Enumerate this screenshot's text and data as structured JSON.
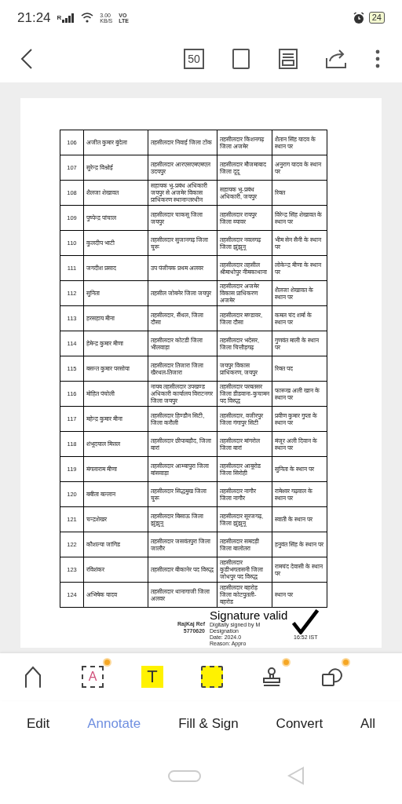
{
  "status_bar": {
    "time": "21:24",
    "carrier_mark": "R",
    "speed_value": "3.00",
    "speed_unit": "KB/S",
    "volte_top": "VO",
    "volte_bottom": "LTE",
    "battery": "24"
  },
  "toolbar": {
    "zoom_label": "50"
  },
  "document": {
    "rows": [
      {
        "number": "106",
        "name": "अजीत कुमार बुंदेला",
        "from": "तहसीलदार निवाई जिला टोंक",
        "to": "तहसीलदार किशनगढ़ जिला अजमेर",
        "remark": "शैतान सिंह यादव के स्थान पर"
      },
      {
        "number": "107",
        "name": "सुरेन्द्र विश्नोई",
        "from": "तहसीलदार आरएसएमएमएल उदयपुर",
        "to": "तहसीलदार मौजमाबाद जिला दूदू",
        "remark": "अनुराग यादव के स्थान पर"
      },
      {
        "number": "108",
        "name": "शैलजा शेखावत",
        "from": "सहायक भू-प्रबंध अधिकारी जयपुर से अजमेर विकास प्राधिकरण स्थानान्तरधीन",
        "to": "सहायक भू-प्रबंध अधिकारी, जयपुर",
        "remark": "रिक्त"
      },
      {
        "number": "109",
        "name": "पुष्पेन्द्र पांचाल",
        "from": "तहसीलदार चाकसू जिला जयपुर",
        "to": "तहसीलदार रायपुर जिला ब्यावर",
        "remark": "विरेन्द्र सिंह शेखावत के स्थान पर"
      },
      {
        "number": "110",
        "name": "कुलदीप भाटी",
        "from": "तहसीलदार सुजानगढ़ जिला चुरू",
        "to": "तहसीलदार नवलगढ़ जिला झुंझुनू",
        "remark": "भीम सेन सैनी के स्थान पर"
      },
      {
        "number": "111",
        "name": "जगदीश प्रसाद",
        "from": "उप पंजीयक प्रथम अलवर",
        "to": "तहसीलदार तहसील श्रीमाधोपुर नीमकाथाना",
        "remark": "लोकेन्द्र मीणा के स्थान पर"
      },
      {
        "number": "112",
        "name": "सुनिता",
        "from": "तहसील जोबनेर जिला जयपुर",
        "to": "तहसीलदार अजमेर विकास प्राधिकरण अजमेर",
        "remark": "शैलजा शेखावत के स्थान पर"
      },
      {
        "number": "113",
        "name": "हरसहाय मीना",
        "from": "तहसीलदार, सैंथल, जिला दौसा",
        "to": "तहसीलदार मण्डावर, जिला दौसा",
        "remark": "कमल चंद शर्मा के स्थान पर"
      },
      {
        "number": "114",
        "name": "हेमेन्द्र कुमार मीणा",
        "from": "तहसीलदार कोटडी जिला भीलवाड़ा",
        "to": "तहसीलदार भदेसर, जिला चित्तौड़गढ़",
        "remark": "गुणवंत माली के स्थान पर"
      },
      {
        "number": "115",
        "name": "बसन्त कुमार परसोया",
        "from": "तहसीलदार तिजारा जिला खैरथल-तिजारा",
        "to": "जयपुर विकास प्राधिकरण, जयपुर",
        "remark": "रिक्त पद"
      },
      {
        "number": "116",
        "name": "मोहित पंचोली",
        "from": "नायब तहसीलदार उपखण्ड अधिकारी कार्यालय विराटनगर जिला जयपुर",
        "to": "तहसीलदार परबतसर जिला डीडवाना-कुचामन पद विरुद्ध",
        "remark": "फारूख अली खान के स्थान पर"
      },
      {
        "number": "117",
        "name": "महेन्द्र कुमार मीना",
        "from": "तहसीलदार हिण्डौन सिटी, जिला करौली",
        "to": "तहसीलदार, वजीरपुर जिला गंगापुर सिटी",
        "remark": "प्रवीण कुमार गुप्ता के स्थान पर"
      },
      {
        "number": "118",
        "name": "शंभूदयाल मित्तल",
        "from": "तहसीलदार छीपाबड़ौद, जिला बारां",
        "to": "तहसीलदार मांगरोल जिला बारां",
        "remark": "मंजूर अली दिवान के स्थान पर"
      },
      {
        "number": "119",
        "name": "मंगलाराम मीणा",
        "from": "तहसीलदार आम्बापुरा जिला बांसवाड़ा",
        "to": "तहसीलदार आबूरोड जिला सिरोही",
        "remark": "सुनिता के स्थान पर"
      },
      {
        "number": "120",
        "name": "बबीता बल्लान",
        "from": "तहसीलदार सिद्धमुख जिला चुरू",
        "to": "तहसीलदार नागौर जिला नागौर",
        "remark": "रामेश्वर गढ़वाल के स्थान पर"
      },
      {
        "number": "121",
        "name": "चन्द्रशेखर",
        "from": "तहसीलदार बिसाऊ जिला झुंझुनू",
        "to": "तहसीलदार सूरजगढ़, जिला झुंझुनू",
        "remark": "स्वाती के स्थान पर"
      },
      {
        "number": "122",
        "name": "कौशल्या जांगिड",
        "from": "तहसीलदार जसवंतपुरा जिला जालौर",
        "to": "तहसीलदार समदड़ी जिला बालोतरा",
        "remark": "हनुवंत सिंह के स्थान पर"
      },
      {
        "number": "123",
        "name": "रविशंकर",
        "from": "तहसीलदार बीकानेर पद विरुद्ध",
        "to": "तहसीलदार कुडीभगतासनी जिला जोधपुर पद विरुद्ध",
        "remark": "रामचंद देवासी के स्थान पर"
      },
      {
        "number": "124",
        "name": "अभिषेक यादव",
        "from": "तहसीलदार थानागाजी जिला अलवर",
        "to": "तहसीलदार बहरोड़ जिला कोटपुतली-बहरोड",
        "remark": "स्थान पर"
      }
    ],
    "stamp": {
      "label": "RajKaj Ref",
      "number": "5770620"
    },
    "signature": {
      "title": "Signature valid",
      "lines": [
        "Digitally signed by M",
        "Designation",
        "Date: 2024.0",
        "Reason: Appro"
      ],
      "time": "16:52 IST"
    }
  },
  "tools": [
    {
      "kind": "pen",
      "premium": false
    },
    {
      "kind": "text-box",
      "glyph": "A",
      "premium": true
    },
    {
      "kind": "highlight",
      "glyph": "T",
      "premium": false
    },
    {
      "kind": "area",
      "premium": false
    },
    {
      "kind": "stamp",
      "premium": true
    },
    {
      "kind": "shape",
      "premium": true
    }
  ],
  "tabs": [
    {
      "label": "Edit",
      "selected": false
    },
    {
      "label": "Annotate",
      "selected": true
    },
    {
      "label": "Fill & Sign",
      "selected": false
    },
    {
      "label": "Convert",
      "selected": false
    },
    {
      "label": "All",
      "selected": false
    }
  ]
}
